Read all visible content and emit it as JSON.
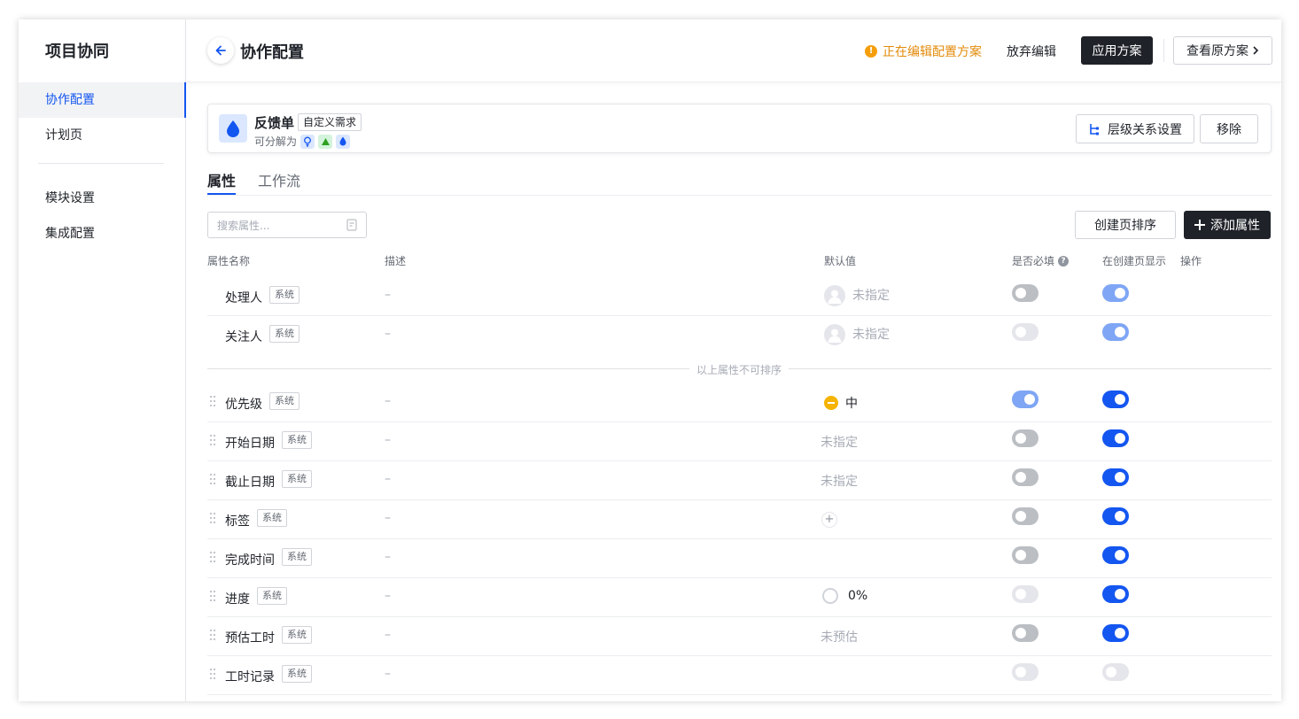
{
  "app": {
    "title": "项目协同"
  },
  "sidebar": {
    "items": [
      {
        "label": "协作配置",
        "active": true
      },
      {
        "label": "计划页",
        "active": false
      },
      {
        "label": "模块设置",
        "active": false
      },
      {
        "label": "集成配置",
        "active": false
      }
    ]
  },
  "header": {
    "title": "协作配置",
    "status": "正在编辑配置方案",
    "discard": "放弃编辑",
    "apply": "应用方案",
    "view_original": "查看原方案"
  },
  "card": {
    "name": "反馈单",
    "tag": "自定义需求",
    "subtitle": "可分解为",
    "hierarchy_button": "层级关系设置",
    "remove_button": "移除"
  },
  "tabs": [
    {
      "label": "属性",
      "active": true
    },
    {
      "label": "工作流",
      "active": false
    }
  ],
  "toolbar": {
    "search_placeholder": "搜索属性...",
    "sort_button": "创建页排序",
    "add_button": "添加属性"
  },
  "columns": {
    "name": "属性名称",
    "desc": "描述",
    "default": "默认值",
    "required": "是否必填",
    "show": "在创建页显示",
    "actions": "操作"
  },
  "divider_label": "以上属性不可排序",
  "system_tag": "系统",
  "rows": [
    {
      "name": "处理人",
      "desc": "–",
      "default": "未指定",
      "default_kind": "avatar",
      "required": "off",
      "show": "on-disabled",
      "draggable": false
    },
    {
      "name": "关注人",
      "desc": "–",
      "default": "未指定",
      "default_kind": "avatar",
      "required": "off-disabled",
      "show": "on-disabled",
      "draggable": false
    },
    {
      "name": "优先级",
      "desc": "–",
      "default": "中",
      "default_kind": "priority",
      "required": "on-disabled",
      "show": "on",
      "draggable": true
    },
    {
      "name": "开始日期",
      "desc": "–",
      "default": "未指定",
      "default_kind": "text",
      "required": "off",
      "show": "on",
      "draggable": true
    },
    {
      "name": "截止日期",
      "desc": "–",
      "default": "未指定",
      "default_kind": "text",
      "required": "off",
      "show": "on",
      "draggable": true
    },
    {
      "name": "标签",
      "desc": "–",
      "default": "+",
      "default_kind": "add",
      "required": "off",
      "show": "on",
      "draggable": true
    },
    {
      "name": "完成时间",
      "desc": "–",
      "default": "",
      "default_kind": "none",
      "required": "off",
      "show": "on",
      "draggable": true
    },
    {
      "name": "进度",
      "desc": "–",
      "default": "0%",
      "default_kind": "progress",
      "required": "off-disabled",
      "show": "on",
      "draggable": true
    },
    {
      "name": "预估工时",
      "desc": "–",
      "default": "未预估",
      "default_kind": "text",
      "required": "off",
      "show": "on",
      "draggable": true
    },
    {
      "name": "工时记录",
      "desc": "–",
      "default": "",
      "default_kind": "none",
      "required": "off-disabled",
      "show": "off-disabled",
      "draggable": true
    }
  ],
  "colors": {
    "accent": "#1456f0",
    "warning": "#e38b0b",
    "dark": "#1f2329"
  }
}
